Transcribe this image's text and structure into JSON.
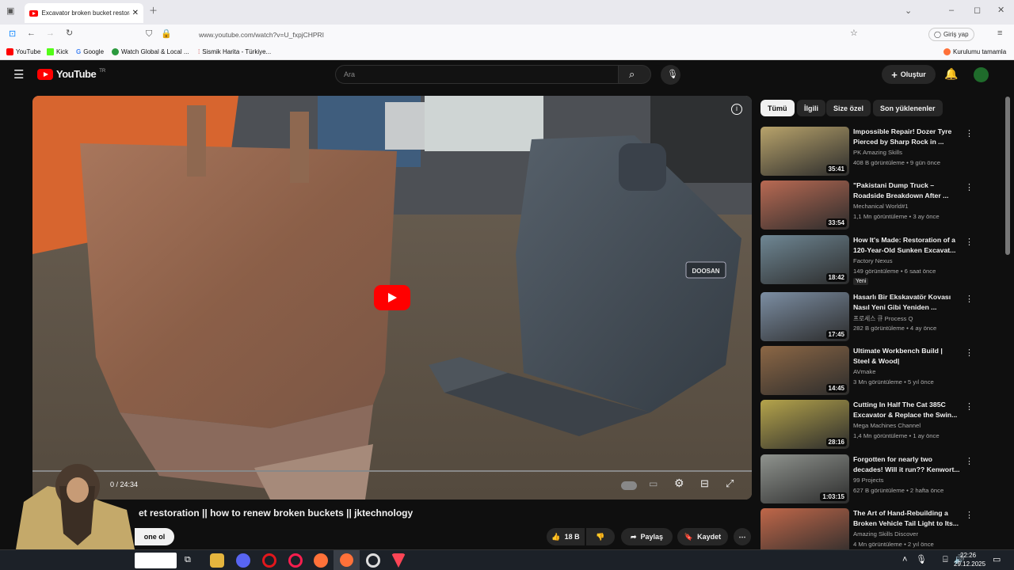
{
  "browser": {
    "tab_title": "Excavator broken bucket restora",
    "url": "www.youtube.com/watch?v=U_fxpjCHPRI",
    "login": "Giriş yap"
  },
  "bookmarks": [
    "YouTube",
    "Kick",
    "Google",
    "Watch Global & Local ...",
    "Sismik Harita - Türkiye..."
  ],
  "bookmark_right": "Kurulumu tamamla",
  "header": {
    "logo": "YouTube",
    "region": "TR",
    "search_placeholder": "Ara",
    "create": "Oluştur"
  },
  "player": {
    "time": "0 / 24:34",
    "play": "▶"
  },
  "video": {
    "title": "et restoration || how to renew broken buckets || jktechnology",
    "subscribe": "one ol",
    "likes": "18 B",
    "share": "Paylaş",
    "save": "Kaydet"
  },
  "chips": [
    "Tümü",
    "İlgili",
    "Size özel",
    "Son yüklenenler"
  ],
  "recommendations": [
    {
      "title": "Impossible Repair! Dozer Tyre Pierced by Sharp Rock in ...",
      "channel": "PK Amazing Skills",
      "meta": "408 B görüntüleme • 9 gün önce",
      "duration": "35:41",
      "color": "#b8a36b"
    },
    {
      "title": "\"Pakistani Dump Truck – Roadside Breakdown After ...",
      "channel": "Mechanical World#1",
      "meta": "1,1 Mn görüntüleme • 3 ay önce",
      "duration": "33:54",
      "color": "#b96a53"
    },
    {
      "title": "How It's Made: Restoration of a 120-Year-Old Sunken Excavat...",
      "channel": "Factory Nexus",
      "meta": "149 görüntüleme • 6 saat önce",
      "duration": "18:42",
      "badge": "Yeni",
      "color": "#6f8794"
    },
    {
      "title": "Hasarlı Bir Ekskavatör Kovası Nasıl Yeni Gibi Yeniden ...",
      "channel": "프로세스 큐 Process Q",
      "meta": "282 B görüntüleme • 4 ay önce",
      "duration": "17:45",
      "color": "#7c8ea3"
    },
    {
      "title": "Ultimate Workbench Build | Steel & Wood|",
      "channel": "AVmake",
      "meta": "3 Mn görüntüleme • 5 yıl önce",
      "duration": "14:45",
      "color": "#8c6745"
    },
    {
      "title": "Cutting In Half The Cat 385C Excavator & Replace the Swin...",
      "channel": "Mega Machines Channel",
      "meta": "1,4 Mn görüntüleme • 1 ay önce",
      "duration": "28:16",
      "color": "#b5a44b"
    },
    {
      "title": "Forgotten for nearly two decades! Will it run?? Kenwort...",
      "channel": "99 Projects",
      "meta": "627 B görüntüleme • 2 hafta önce",
      "duration": "1:03:15",
      "color": "#8f938e"
    },
    {
      "title": "The Art of Hand-Rebuilding a Broken Vehicle Tail Light to Its...",
      "channel": "Amazing Skills Discover",
      "meta": "4 Mn görüntüleme • 2 yıl önce",
      "duration": "",
      "color": "#c06749"
    }
  ],
  "taskbar": {
    "time": "22:26",
    "date": "29.12.2025"
  }
}
